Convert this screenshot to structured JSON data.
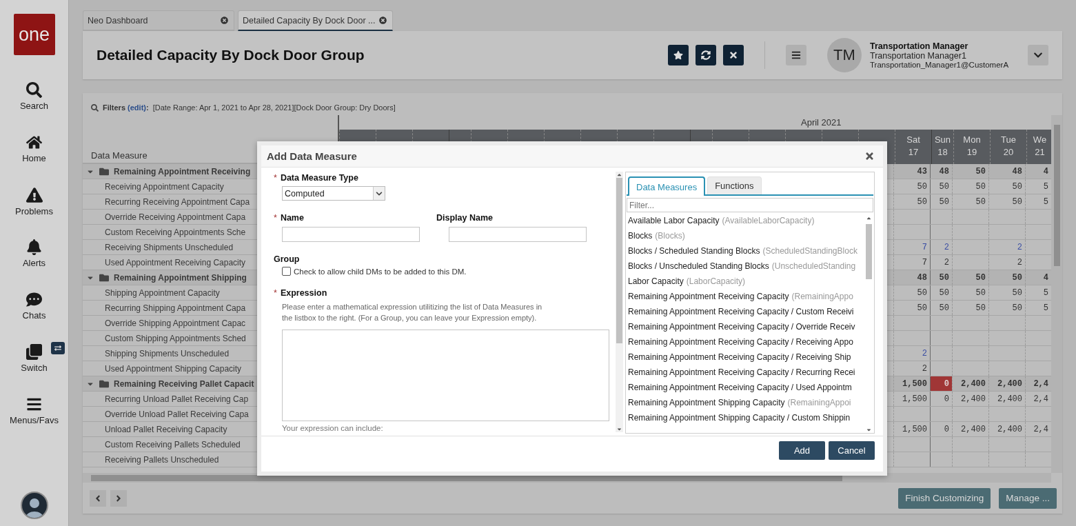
{
  "sidebar": {
    "logo": "one",
    "items": [
      {
        "label": "Search"
      },
      {
        "label": "Home"
      },
      {
        "label": "Problems"
      },
      {
        "label": "Alerts"
      },
      {
        "label": "Chats"
      },
      {
        "label": "Switch"
      },
      {
        "label": "Menus/Favs"
      }
    ]
  },
  "tabs": [
    {
      "label": "Neo Dashboard",
      "selected": false
    },
    {
      "label": "Detailed Capacity By Dock Door ...",
      "selected": true
    }
  ],
  "header": {
    "title": "Detailed Capacity By Dock Door Group",
    "user": {
      "initials": "TM",
      "role": "Transportation Manager",
      "name": "Transportation Manager1",
      "email": "Transportation_Manager1@CustomerA"
    }
  },
  "filters": {
    "label": "Filters",
    "link": "(edit)",
    "suffix": ":",
    "summary": "[Date Range: Apr 1, 2021 to Apr 28, 2021][Dock Door Group: Dry Doors]"
  },
  "grid": {
    "column_header": "Data Measure",
    "month": "April 2021",
    "days": [
      {
        "day": "Sat",
        "date": "17"
      },
      {
        "day": "Sun",
        "date": "18"
      },
      {
        "day": "Mon",
        "date": "19"
      },
      {
        "day": "Tue",
        "date": "20"
      },
      {
        "day": "We",
        "date": "21"
      }
    ],
    "groups": [
      {
        "label": "Remaining Appointment Receiving",
        "expanded": true,
        "values": [
          {
            "text": "43",
            "flagged": false
          },
          {
            "text": "48",
            "flagged": false
          },
          {
            "text": "50",
            "flagged": false
          },
          {
            "text": "48",
            "flagged": false
          },
          {
            "text": "4",
            "flagged": false
          }
        ],
        "children": [
          {
            "label": "Receiving Appointment Capacity",
            "link": false,
            "values": [
              {
                "text": "50",
                "flagged": false
              },
              {
                "text": "50",
                "flagged": false
              },
              {
                "text": "50",
                "flagged": false
              },
              {
                "text": "50",
                "flagged": false
              },
              {
                "text": "5",
                "flagged": false
              }
            ]
          },
          {
            "label": "Recurring Receiving Appointment Capa",
            "link": false,
            "values": [
              {
                "text": "50",
                "flagged": false
              },
              {
                "text": "50",
                "flagged": false
              },
              {
                "text": "50",
                "flagged": false
              },
              {
                "text": "50",
                "flagged": false
              },
              {
                "text": "5",
                "flagged": false
              }
            ]
          },
          {
            "label": "Override Receiving Appointment Capa",
            "link": false
          },
          {
            "label": "Custom Receiving Appointments Sche",
            "link": false
          },
          {
            "label": "Receiving Shipments Unscheduled",
            "link": true,
            "values": [
              {
                "text": "7",
                "flagged": false
              },
              {
                "text": "2",
                "flagged": false
              },
              {
                "flagged": false
              },
              {
                "text": "2",
                "flagged": false
              },
              {
                "flagged": false
              }
            ]
          },
          {
            "label": "Used Appointment Receiving Capacity",
            "link": false,
            "values": [
              {
                "text": "7",
                "flagged": false
              },
              {
                "text": "2",
                "flagged": false
              },
              {
                "flagged": false
              },
              {
                "text": "2",
                "flagged": false
              },
              {
                "flagged": false
              }
            ]
          }
        ]
      },
      {
        "label": "Remaining Appointment Shipping",
        "expanded": true,
        "values": [
          {
            "text": "48",
            "flagged": false
          },
          {
            "text": "50",
            "flagged": false
          },
          {
            "text": "50",
            "flagged": false
          },
          {
            "text": "50",
            "flagged": false
          },
          {
            "text": "4",
            "flagged": false
          }
        ],
        "children": [
          {
            "label": "Shipping Appointment Capacity",
            "link": false,
            "values": [
              {
                "text": "50",
                "flagged": false
              },
              {
                "text": "50",
                "flagged": false
              },
              {
                "text": "50",
                "flagged": false
              },
              {
                "text": "50",
                "flagged": false
              },
              {
                "text": "5",
                "flagged": false
              }
            ]
          },
          {
            "label": "Recurring Shipping Appointment Capa",
            "link": false,
            "values": [
              {
                "text": "50",
                "flagged": false
              },
              {
                "text": "50",
                "flagged": false
              },
              {
                "text": "50",
                "flagged": false
              },
              {
                "text": "50",
                "flagged": false
              },
              {
                "text": "5",
                "flagged": false
              }
            ]
          },
          {
            "label": "Override Shipping Appointment Capac",
            "link": false
          },
          {
            "label": "Custom Shipping Appointments Sched",
            "link": false
          },
          {
            "label": "Shipping Shipments Unscheduled",
            "link": true,
            "values": [
              {
                "text": "2",
                "flagged": false
              }
            ]
          },
          {
            "label": "Used Appointment Shipping Capacity",
            "link": false,
            "values": [
              {
                "text": "2",
                "flagged": false
              }
            ]
          }
        ]
      },
      {
        "label": "Remaining Receiving Pallet Capacit",
        "expanded": true,
        "values": [
          {
            "text": "1,500",
            "flagged": false
          },
          {
            "text": "0",
            "flagged": true
          },
          {
            "text": "2,400",
            "flagged": false
          },
          {
            "text": "2,400",
            "flagged": false
          },
          {
            "text": "2,4",
            "flagged": false
          }
        ],
        "children": [
          {
            "label": "Recurring Unload Pallet Receiving Cap",
            "link": false,
            "values": [
              {
                "text": "1,500",
                "flagged": false
              },
              {
                "text": "0",
                "flagged": false
              },
              {
                "text": "2,400",
                "flagged": false
              },
              {
                "text": "2,400",
                "flagged": false
              },
              {
                "text": "2,4",
                "flagged": false
              }
            ]
          },
          {
            "label": "Override Unload Pallet Receiving Capa",
            "link": false
          },
          {
            "label": "Unload Pallet Receiving Capacity",
            "link": false,
            "values": [
              {
                "text": "1,500",
                "flagged": false
              },
              {
                "text": "0",
                "flagged": false
              },
              {
                "text": "2,400",
                "flagged": false
              },
              {
                "text": "2,400",
                "flagged": false
              },
              {
                "text": "2,4",
                "flagged": false
              }
            ]
          },
          {
            "label": "Custom Receiving Pallets Scheduled",
            "link": false
          },
          {
            "label": "Receiving Pallets Unscheduled",
            "link": false
          }
        ]
      }
    ]
  },
  "footer": {
    "buttons": [
      "Finish Customizing",
      "Manage ..."
    ]
  },
  "dialog": {
    "title": "Add Data Measure",
    "type_field": {
      "label": "Data Measure Type",
      "required_mark": "*",
      "value": "Computed"
    },
    "name_field": {
      "label": "Name",
      "required_mark": "*"
    },
    "display_name_field": {
      "label": "Display Name"
    },
    "group": {
      "label": "Group",
      "checkbox_label": "Check to allow child DMs to be added to this DM.",
      "checked": false
    },
    "expression": {
      "label": "Expression",
      "required_mark": "*",
      "help": [
        "Please enter a mathematical expression utilitizing the list of Data Measures in",
        "the listbox to the right. (For a Group, you can leave your Expression empty)."
      ],
      "footnote": "Your expression can include:"
    },
    "tabs": [
      {
        "label": "Data Measures",
        "selected": true
      },
      {
        "label": "Functions",
        "selected": false
      }
    ],
    "filter_placeholder": "Filter...",
    "measures": [
      {
        "name": "Available Labor Capacity",
        "code": "(AvailableLaborCapacity)"
      },
      {
        "name": "Blocks",
        "code": "(Blocks)"
      },
      {
        "name": "Blocks / Scheduled Standing Blocks",
        "code": "(ScheduledStandingBlock"
      },
      {
        "name": "Blocks / Unscheduled Standing Blocks",
        "code": "(UnscheduledStanding"
      },
      {
        "name": "Labor Capacity",
        "code": "(LaborCapacity)"
      },
      {
        "name": "Remaining Appointment Receiving Capacity",
        "code": "(RemainingAppo"
      },
      {
        "name": "Remaining Appointment Receiving Capacity / Custom Receivi"
      },
      {
        "name": "Remaining Appointment Receiving Capacity / Override Receiv"
      },
      {
        "name": "Remaining Appointment Receiving Capacity / Receiving Appo"
      },
      {
        "name": "Remaining Appointment Receiving Capacity / Receiving Ship"
      },
      {
        "name": "Remaining Appointment Receiving Capacity / Recurring Recei"
      },
      {
        "name": "Remaining Appointment Receiving Capacity / Used Appointm"
      },
      {
        "name": "Remaining Appointment Shipping Capacity",
        "code": "(RemainingAppoi"
      },
      {
        "name": "Remaining Appointment Shipping Capacity / Custom Shippin"
      }
    ],
    "buttons": [
      "Add",
      "Cancel"
    ]
  }
}
